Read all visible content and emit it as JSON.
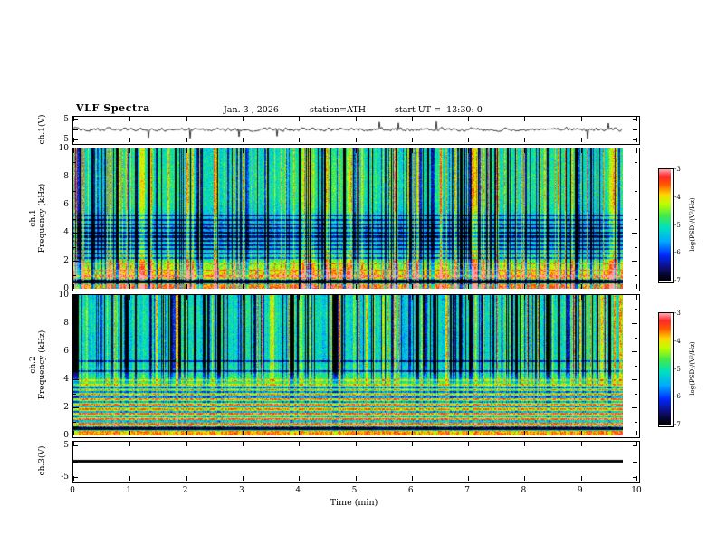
{
  "header": {
    "title": "VLF Spectra",
    "date": "Jan. 3 , 2026",
    "station": "station=ATH",
    "start_ut": "start UT =  13:30: 0"
  },
  "axes": {
    "x_label": "Time (min)",
    "x_tick_labels": [
      "0",
      "1",
      "2",
      "3",
      "4",
      "5",
      "6",
      "7",
      "8",
      "9",
      "10"
    ],
    "spec_y_tick_labels": [
      "10",
      "8",
      "6",
      "4",
      "2",
      "0"
    ],
    "wave_y_tick_labels": [
      "5",
      "-5"
    ]
  },
  "panels": {
    "ch1_wave": {
      "ylabel": "ch.1(V)"
    },
    "ch1_spec": {
      "ylabel_line1": "ch.1",
      "ylabel_line2": "Frequency (kHz)"
    },
    "ch2_spec": {
      "ylabel_line1": "ch.2",
      "ylabel_line2": "Frequency (kHz)"
    },
    "ch3_wave": {
      "ylabel": "ch.3(V)"
    }
  },
  "colorbar": {
    "label": "log(PSD)/(V²/Hz)",
    "tick_labels": [
      "-3",
      "-4",
      "-5",
      "-6",
      "-7"
    ],
    "value_range": [
      -7,
      -3
    ],
    "colormap_stops": [
      [
        -7,
        "#000000"
      ],
      [
        -6.55,
        "#0f0f78"
      ],
      [
        -6.1,
        "#0028ff"
      ],
      [
        -5.6,
        "#00aaff"
      ],
      [
        -5.1,
        "#00e1be"
      ],
      [
        -4.65,
        "#46eb46"
      ],
      [
        -4.25,
        "#beff00"
      ],
      [
        -3.9,
        "#ffd700"
      ],
      [
        -3.55,
        "#ff5a00"
      ],
      [
        -3.25,
        "#ff2828"
      ],
      [
        -3,
        "#ffa5af"
      ]
    ]
  },
  "chart_data": [
    {
      "type": "line",
      "name": "ch1-waveform",
      "ylabel": "ch.1(V)",
      "ylim": [
        -5,
        5
      ],
      "yticks": [
        5,
        -5
      ],
      "x_range_min": [
        0,
        9.75
      ],
      "summary": "broadband noisy voltage trace, mean 0 V, rms ~0.7 V, impulsive sferic spikes reaching about ±4 V",
      "seed": 20260103,
      "ar": 0.55,
      "sigma": 0.55,
      "spike_prob": 0.022,
      "spike_amp": [
        1.5,
        4.2
      ]
    },
    {
      "type": "heatmap",
      "name": "ch1-spectrogram",
      "ylabel": "ch.1 Frequency (kHz)",
      "flim_khz": [
        0,
        10
      ],
      "yticks_khz": [
        0,
        2,
        4,
        6,
        8,
        10
      ],
      "x_range_min": [
        0,
        9.75
      ],
      "clim_log_psd": [
        -7,
        -3
      ],
      "summary": "full-band vertical sferic streaks (dark blue/black and bright green); intense red-yellow band below ~2 kHz; black notch 0.36-0.58 kHz; darker blue harmonic lines 2.2-5.2 kHz; green-cyan background above 5 kHz",
      "seed": 771,
      "base_profile": [
        [
          0,
          -3.5
        ],
        [
          0.3,
          -3.6
        ],
        [
          0.36,
          -6.9
        ],
        [
          0.58,
          -6.9
        ],
        [
          0.68,
          -3.8
        ],
        [
          1.1,
          -3.95
        ],
        [
          1.6,
          -4.35
        ],
        [
          2.1,
          -4.8
        ],
        [
          2.8,
          -5.2
        ],
        [
          4,
          -5.55
        ],
        [
          5.2,
          -5.25
        ],
        [
          6.2,
          -5.0
        ],
        [
          8,
          -4.95
        ],
        [
          10,
          -5.1
        ]
      ],
      "notch_khz": [
        0.36,
        0.58
      ],
      "dark_lines_khz": [
        2.2,
        2.5,
        2.8,
        3.1,
        3.4,
        3.7,
        4.0,
        4.3,
        4.6,
        4.9,
        5.2
      ],
      "bright_lines_khz": [
        0.85,
        1.3,
        1.75
      ],
      "dark_col_prob": 0.27,
      "bright_col_prob": 0.2,
      "vweight": [
        [
          0,
          1
        ],
        [
          10,
          1
        ]
      ]
    },
    {
      "type": "heatmap",
      "name": "ch2-spectrogram",
      "ylabel": "ch.2 Frequency (kHz)",
      "flim_khz": [
        0,
        10
      ],
      "yticks_khz": [
        0,
        2,
        4,
        6,
        8,
        10
      ],
      "x_range_min": [
        0,
        9.75
      ],
      "clim_log_psd": [
        -7,
        -3
      ],
      "summary": "dense horizontal red/yellow harmonic striping below ~4 kHz on green background; solid black notch near 0.4 kHz; cyan-blue upper band with dark vertical sferic streaks above 5 kHz",
      "seed": 772,
      "base_profile": [
        [
          0,
          -3.6
        ],
        [
          0.3,
          -3.75
        ],
        [
          0.36,
          -6.8
        ],
        [
          0.55,
          -6.8
        ],
        [
          0.65,
          -3.9
        ],
        [
          1.2,
          -4.1
        ],
        [
          2,
          -4.3
        ],
        [
          3,
          -4.5
        ],
        [
          3.8,
          -4.7
        ],
        [
          4.6,
          -5.0
        ],
        [
          5.4,
          -5.15
        ],
        [
          7,
          -5.2
        ],
        [
          8.5,
          -5.05
        ],
        [
          10,
          -5.2
        ]
      ],
      "notch_khz": [
        0.36,
        0.55
      ],
      "dark_lines_khz": [
        0.975,
        1.325,
        1.675,
        2.025,
        2.375,
        2.725,
        3.075,
        3.425,
        4.6,
        5.3
      ],
      "bright_lines_khz": [
        0.8,
        1.15,
        1.5,
        1.85,
        2.2,
        2.55,
        2.9,
        3.25,
        3.6,
        3.95
      ],
      "dark_col_prob": 0.3,
      "bright_col_prob": 0.16,
      "vweight": [
        [
          0,
          0.22
        ],
        [
          3.5,
          0.3
        ],
        [
          5,
          1
        ],
        [
          10,
          1
        ]
      ]
    },
    {
      "type": "line",
      "name": "ch3-waveform",
      "ylabel": "ch.3(V)",
      "ylim": [
        -5,
        5
      ],
      "yticks": [
        5,
        -5
      ],
      "x_range_min": [
        0,
        9.75
      ],
      "summary": "constant 0 V — flat thick black line (channel inactive)",
      "constant_value": 0
    }
  ]
}
